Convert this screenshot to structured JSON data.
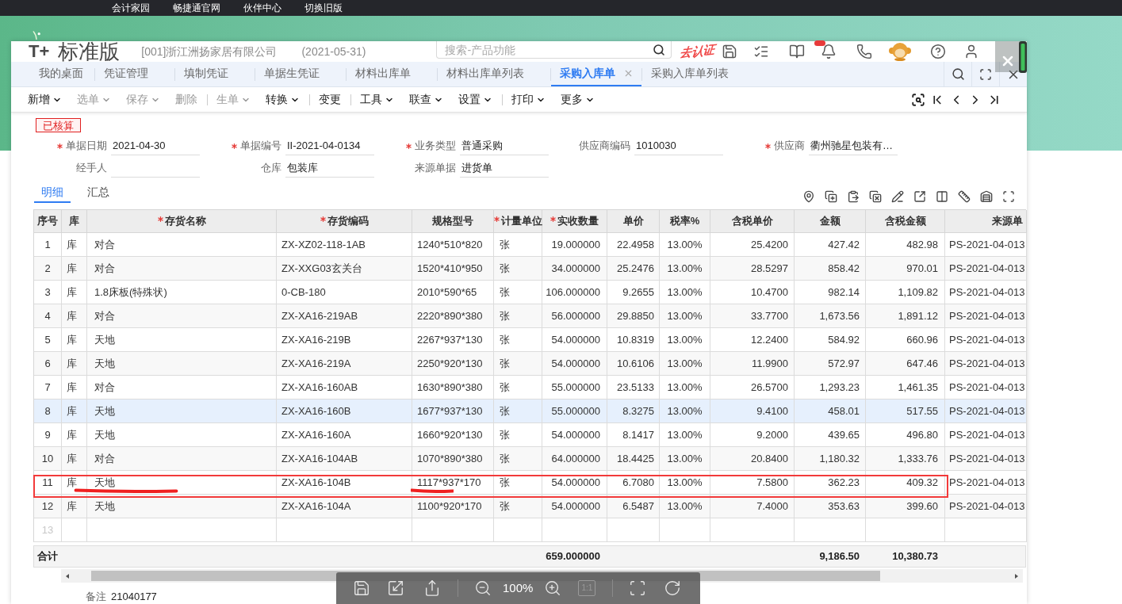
{
  "top_links": [
    "会计家园",
    "畅捷通官网",
    "伙伴中心",
    "切换旧版"
  ],
  "header": {
    "logo": "T+",
    "product": "标准版",
    "company": "[001]浙江洲扬家居有限公司",
    "date": "(2021-05-31)",
    "search": {
      "placeholder": "搜索-产品功能"
    },
    "certify": "去认证",
    "notification_badge": true
  },
  "tabs": [
    {
      "label": "我的桌面",
      "selected": false
    },
    {
      "label": "凭证管理",
      "selected": false
    },
    {
      "label": "填制凭证",
      "selected": false
    },
    {
      "label": "单据生凭证",
      "selected": false
    },
    {
      "label": "材料出库单",
      "selected": false
    },
    {
      "label": "材料出库单列表",
      "selected": false
    },
    {
      "label": "采购入库单",
      "selected": true
    },
    {
      "label": "采购入库单列表",
      "selected": false
    }
  ],
  "toolbar": [
    {
      "label": "新增",
      "dropdown": true,
      "disabled": false,
      "separator_before": false
    },
    {
      "label": "选单",
      "dropdown": true,
      "disabled": true,
      "separator_before": false
    },
    {
      "label": "保存",
      "dropdown": true,
      "disabled": true,
      "separator_before": false
    },
    {
      "label": "删除",
      "dropdown": false,
      "disabled": true,
      "separator_before": false
    },
    {
      "label": "生单",
      "dropdown": true,
      "disabled": true,
      "separator_before": true
    },
    {
      "label": "转换",
      "dropdown": true,
      "disabled": false,
      "separator_before": false
    },
    {
      "label": "变更",
      "dropdown": false,
      "disabled": false,
      "separator_before": true
    },
    {
      "label": "工具",
      "dropdown": true,
      "disabled": false,
      "separator_before": true
    },
    {
      "label": "联查",
      "dropdown": true,
      "disabled": false,
      "separator_before": false
    },
    {
      "label": "设置",
      "dropdown": true,
      "disabled": false,
      "separator_before": false
    },
    {
      "label": "打印",
      "dropdown": true,
      "disabled": false,
      "separator_before": true
    },
    {
      "label": "更多",
      "dropdown": true,
      "disabled": false,
      "separator_before": false
    }
  ],
  "status": "已核算",
  "form": [
    [
      {
        "label": "单据日期",
        "required": true,
        "value": "2021-04-30"
      },
      {
        "label": "单据编号",
        "required": true,
        "value": "II-2021-04-0134"
      },
      {
        "label": "业务类型",
        "required": true,
        "value": "普通采购"
      },
      {
        "label": "供应商编码",
        "required": false,
        "value": "1010030"
      },
      {
        "label": "供应商",
        "required": true,
        "value": "衢州驰星包装有…"
      }
    ],
    [
      {
        "label": "经手人",
        "required": false
      },
      {
        "label": "仓库",
        "required": false,
        "value": "包装库"
      },
      {
        "label": "来源单据",
        "required": false,
        "value": "进货单"
      }
    ]
  ],
  "detail_tabs": [
    {
      "label": "明细",
      "selected": true
    },
    {
      "label": "汇总",
      "selected": false
    }
  ],
  "table": {
    "columns": [
      {
        "label": "序号",
        "required": false
      },
      {
        "label": "库",
        "required": false
      },
      {
        "label": "存货名称",
        "required": true
      },
      {
        "label": "存货编码",
        "required": true
      },
      {
        "label": "规格型号",
        "required": false
      },
      {
        "label": "计量单位",
        "required": true
      },
      {
        "label": "实收数量",
        "required": true
      },
      {
        "label": "单价",
        "required": false
      },
      {
        "label": "税率%",
        "required": false
      },
      {
        "label": "含税单价",
        "required": false
      },
      {
        "label": "金额",
        "required": false
      },
      {
        "label": "含税金额",
        "required": false
      },
      {
        "label": "来源单",
        "required": false
      }
    ],
    "rows": [
      {
        "kind": "data",
        "selected": false,
        "marked": false,
        "cells": [
          "1",
          "库",
          "对合",
          "ZX-XZ02-118-1AB",
          "1240*510*820",
          "张",
          "19.000000",
          "22.4958",
          "13.00%",
          "25.4200",
          "427.42",
          "482.98",
          "PS-2021-04-013"
        ]
      },
      {
        "kind": "data",
        "selected": false,
        "marked": false,
        "cells": [
          "2",
          "库",
          "对合",
          "ZX-XXG03玄关台",
          "1520*410*950",
          "张",
          "34.000000",
          "25.2476",
          "13.00%",
          "28.5297",
          "858.42",
          "970.01",
          "PS-2021-04-013"
        ]
      },
      {
        "kind": "data",
        "selected": false,
        "marked": false,
        "cells": [
          "3",
          "库",
          "1.8床板(特殊状)",
          "0-CB-180",
          "2010*590*65",
          "张",
          "106.000000",
          "9.2655",
          "13.00%",
          "10.4700",
          "982.14",
          "1,109.82",
          "PS-2021-04-013"
        ]
      },
      {
        "kind": "data",
        "selected": false,
        "marked": false,
        "cells": [
          "4",
          "库",
          "对合",
          "ZX-XA16-219AB",
          "2220*890*380",
          "张",
          "56.000000",
          "29.8850",
          "13.00%",
          "33.7700",
          "1,673.56",
          "1,891.12",
          "PS-2021-04-013"
        ]
      },
      {
        "kind": "data",
        "selected": false,
        "marked": false,
        "cells": [
          "5",
          "库",
          "天地",
          "ZX-XA16-219B",
          "2267*937*130",
          "张",
          "54.000000",
          "10.8319",
          "13.00%",
          "12.2400",
          "584.92",
          "660.96",
          "PS-2021-04-013"
        ]
      },
      {
        "kind": "data",
        "selected": false,
        "marked": false,
        "cells": [
          "6",
          "库",
          "天地",
          "ZX-XA16-219A",
          "2250*920*130",
          "张",
          "54.000000",
          "10.6106",
          "13.00%",
          "11.9900",
          "572.97",
          "647.46",
          "PS-2021-04-013"
        ]
      },
      {
        "kind": "data",
        "selected": false,
        "marked": false,
        "cells": [
          "7",
          "库",
          "对合",
          "ZX-XA16-160AB",
          "1630*890*380",
          "张",
          "55.000000",
          "23.5133",
          "13.00%",
          "26.5700",
          "1,293.23",
          "1,461.35",
          "PS-2021-04-013"
        ]
      },
      {
        "kind": "data",
        "selected": true,
        "marked": false,
        "cells": [
          "8",
          "库",
          "天地",
          "ZX-XA16-160B",
          "1677*937*130",
          "张",
          "55.000000",
          "8.3275",
          "13.00%",
          "9.4100",
          "458.01",
          "517.55",
          "PS-2021-04-013"
        ]
      },
      {
        "kind": "data",
        "selected": false,
        "marked": false,
        "cells": [
          "9",
          "库",
          "天地",
          "ZX-XA16-160A",
          "1660*920*130",
          "张",
          "54.000000",
          "8.1417",
          "13.00%",
          "9.2000",
          "439.65",
          "496.80",
          "PS-2021-04-013"
        ]
      },
      {
        "kind": "data",
        "selected": false,
        "marked": false,
        "cells": [
          "10",
          "库",
          "对合",
          "ZX-XA16-104AB",
          "1070*890*380",
          "张",
          "64.000000",
          "18.4425",
          "13.00%",
          "20.8400",
          "1,180.32",
          "1,333.76",
          "PS-2021-04-013"
        ]
      },
      {
        "kind": "data",
        "selected": false,
        "marked": true,
        "underlined": [
          false,
          false,
          true,
          false,
          true,
          false,
          false,
          false,
          false,
          false,
          false,
          false,
          false
        ],
        "cells": [
          "11",
          "库",
          "天地",
          "ZX-XA16-104B",
          "1117*937*170",
          "张",
          "54.000000",
          "6.7080",
          "13.00%",
          "7.5800",
          "362.23",
          "409.32",
          "PS-2021-04-013"
        ]
      },
      {
        "kind": "data",
        "selected": false,
        "marked": false,
        "cells": [
          "12",
          "库",
          "天地",
          "ZX-XA16-104A",
          "1100*920*170",
          "张",
          "54.000000",
          "6.5487",
          "13.00%",
          "7.4000",
          "353.63",
          "399.60",
          "PS-2021-04-013"
        ]
      },
      {
        "kind": "blank",
        "selected": false,
        "marked": false,
        "cells": [
          "13"
        ]
      }
    ],
    "totals": {
      "label": "合计",
      "quantity": "659.000000",
      "amount": "9,186.50",
      "amount_with_tax": "10,380.73"
    }
  },
  "remark": {
    "label": "备注",
    "value": "21040177"
  },
  "viewer": {
    "zoom": "100%",
    "actual_size": {
      "label": "1:1",
      "disabled": true
    }
  }
}
